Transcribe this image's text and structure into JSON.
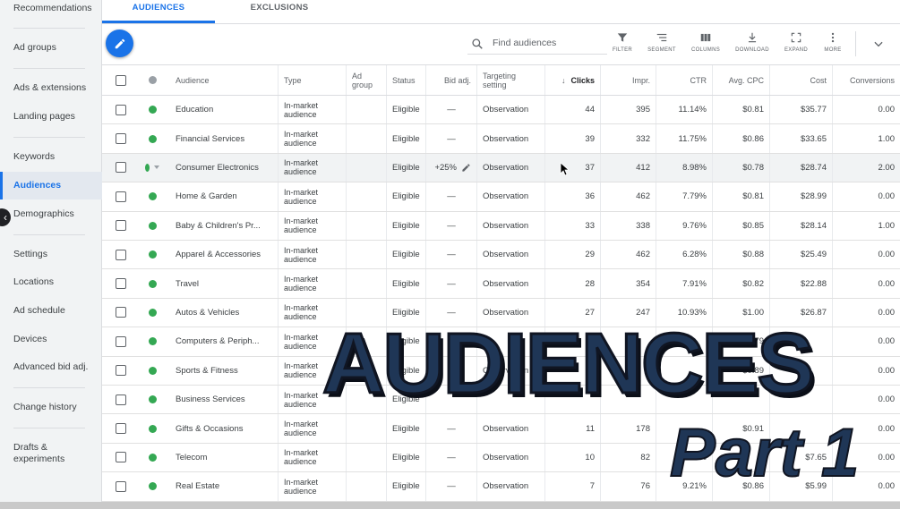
{
  "sidebar": {
    "items": [
      {
        "label": "Recommendations"
      },
      {
        "label": "Ad groups"
      },
      {
        "label": "Ads & extensions"
      },
      {
        "label": "Landing pages"
      },
      {
        "label": "Keywords"
      },
      {
        "label": "Audiences"
      },
      {
        "label": "Demographics"
      },
      {
        "label": "Settings"
      },
      {
        "label": "Locations"
      },
      {
        "label": "Ad schedule"
      },
      {
        "label": "Devices"
      },
      {
        "label": "Advanced bid adj."
      },
      {
        "label": "Change history"
      },
      {
        "label": "Drafts & experiments"
      }
    ],
    "active": "Audiences",
    "collapse_glyph": "‹"
  },
  "tabs": [
    {
      "label": "AUDIENCES",
      "active": true
    },
    {
      "label": "EXCLUSIONS",
      "active": false
    }
  ],
  "search": {
    "placeholder": "Find audiences"
  },
  "tools": [
    {
      "label": "FILTER",
      "icon": "filter-icon"
    },
    {
      "label": "SEGMENT",
      "icon": "segment-icon"
    },
    {
      "label": "COLUMNS",
      "icon": "columns-icon"
    },
    {
      "label": "DOWNLOAD",
      "icon": "download-icon"
    },
    {
      "label": "EXPAND",
      "icon": "expand-icon"
    },
    {
      "label": "MORE",
      "icon": "more-vert-icon"
    }
  ],
  "table": {
    "headers": {
      "audience": "Audience",
      "type": "Type",
      "ad_group": "Ad group",
      "status": "Status",
      "bid_adj": "Bid adj.",
      "targeting": "Targeting setting",
      "clicks": "Clicks",
      "impr": "Impr.",
      "ctr": "CTR",
      "avg_cpc": "Avg. CPC",
      "cost": "Cost",
      "conversions": "Conversions"
    },
    "sort_glyph": "↓",
    "rows": [
      {
        "audience": "Education",
        "type": "In-market audience",
        "ad_group": "",
        "status": "Eligible",
        "bid_adj": "—",
        "targeting": "Observation",
        "clicks": "44",
        "impr": "395",
        "ctr": "11.14%",
        "avg_cpc": "$0.81",
        "cost": "$35.77",
        "conversions": "0.00"
      },
      {
        "audience": "Financial Services",
        "type": "In-market audience",
        "ad_group": "",
        "status": "Eligible",
        "bid_adj": "—",
        "targeting": "Observation",
        "clicks": "39",
        "impr": "332",
        "ctr": "11.75%",
        "avg_cpc": "$0.86",
        "cost": "$33.65",
        "conversions": "1.00"
      },
      {
        "audience": "Consumer Electronics",
        "type": "In-market audience",
        "ad_group": "",
        "status": "Eligible",
        "bid_adj": "+25%",
        "targeting": "Observation",
        "clicks": "37",
        "impr": "412",
        "ctr": "8.98%",
        "avg_cpc": "$0.78",
        "cost": "$28.74",
        "conversions": "2.00"
      },
      {
        "audience": "Home & Garden",
        "type": "In-market audience",
        "ad_group": "",
        "status": "Eligible",
        "bid_adj": "—",
        "targeting": "Observation",
        "clicks": "36",
        "impr": "462",
        "ctr": "7.79%",
        "avg_cpc": "$0.81",
        "cost": "$28.99",
        "conversions": "0.00"
      },
      {
        "audience": "Baby & Children's Pr...",
        "type": "In-market audience",
        "ad_group": "",
        "status": "Eligible",
        "bid_adj": "—",
        "targeting": "Observation",
        "clicks": "33",
        "impr": "338",
        "ctr": "9.76%",
        "avg_cpc": "$0.85",
        "cost": "$28.14",
        "conversions": "1.00"
      },
      {
        "audience": "Apparel & Accessories",
        "type": "In-market audience",
        "ad_group": "",
        "status": "Eligible",
        "bid_adj": "—",
        "targeting": "Observation",
        "clicks": "29",
        "impr": "462",
        "ctr": "6.28%",
        "avg_cpc": "$0.88",
        "cost": "$25.49",
        "conversions": "0.00"
      },
      {
        "audience": "Travel",
        "type": "In-market audience",
        "ad_group": "",
        "status": "Eligible",
        "bid_adj": "—",
        "targeting": "Observation",
        "clicks": "28",
        "impr": "354",
        "ctr": "7.91%",
        "avg_cpc": "$0.82",
        "cost": "$22.88",
        "conversions": "0.00"
      },
      {
        "audience": "Autos & Vehicles",
        "type": "In-market audience",
        "ad_group": "",
        "status": "Eligible",
        "bid_adj": "—",
        "targeting": "Observation",
        "clicks": "27",
        "impr": "247",
        "ctr": "10.93%",
        "avg_cpc": "$1.00",
        "cost": "$26.87",
        "conversions": "0.00"
      },
      {
        "audience": "Computers & Periph...",
        "type": "In-market audience",
        "ad_group": "",
        "status": "Eligible",
        "bid_adj": "",
        "targeting": "",
        "clicks": "",
        "impr": "",
        "ctr": "",
        "avg_cpc": "$0.79",
        "cost": "",
        "conversions": "0.00"
      },
      {
        "audience": "Sports & Fitness",
        "type": "In-market audience",
        "ad_group": "",
        "status": "Eligible",
        "bid_adj": "",
        "targeting": "Observation",
        "clicks": "",
        "impr": "",
        "ctr": "",
        "avg_cpc": "$0.89",
        "cost": "",
        "conversions": "0.00"
      },
      {
        "audience": "Business Services",
        "type": "In-market audience",
        "ad_group": "",
        "status": "Eligible",
        "bid_adj": "",
        "targeting": "",
        "clicks": "",
        "impr": "",
        "ctr": "",
        "avg_cpc": "",
        "cost": "",
        "conversions": "0.00"
      },
      {
        "audience": "Gifts & Occasions",
        "type": "In-market audience",
        "ad_group": "",
        "status": "Eligible",
        "bid_adj": "—",
        "targeting": "Observation",
        "clicks": "11",
        "impr": "178",
        "ctr": "",
        "avg_cpc": "$0.91",
        "cost": "",
        "conversions": "0.00"
      },
      {
        "audience": "Telecom",
        "type": "In-market audience",
        "ad_group": "",
        "status": "Eligible",
        "bid_adj": "—",
        "targeting": "Observation",
        "clicks": "10",
        "impr": "82",
        "ctr": "12.20%",
        "avg_cpc": "",
        "cost": "$7.65",
        "conversions": "0.00"
      },
      {
        "audience": "Real Estate",
        "type": "In-market audience",
        "ad_group": "",
        "status": "Eligible",
        "bid_adj": "—",
        "targeting": "Observation",
        "clicks": "7",
        "impr": "76",
        "ctr": "9.21%",
        "avg_cpc": "$0.86",
        "cost": "$5.99",
        "conversions": "0.00"
      }
    ]
  },
  "overlay": {
    "title": "AUDIENCES",
    "subtitle": "Part 1"
  },
  "colors": {
    "accent": "#1a73e8",
    "status_green": "#34a853",
    "overlay_navy": "#1f3656"
  }
}
